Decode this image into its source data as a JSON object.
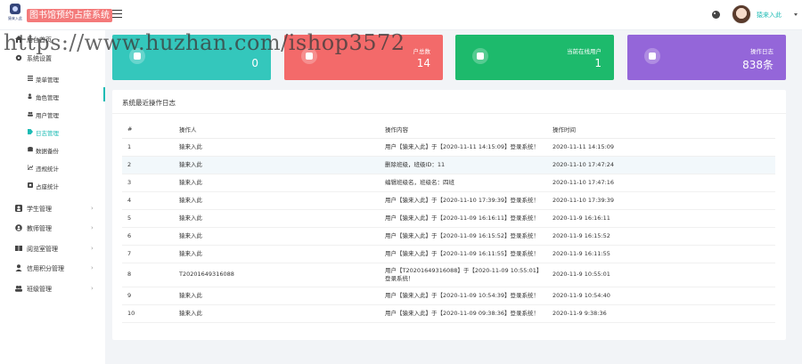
{
  "header": {
    "logo_text": "猿来入此",
    "app_title": "图书馆预约占座系统",
    "user_name": "猿来入此"
  },
  "watermark": "https://www.huzhan.com/ishop3572",
  "sidebar": {
    "items": [
      {
        "label": "后台首页",
        "icon": "home-icon"
      },
      {
        "label": "系统设置",
        "icon": "gear-icon"
      },
      {
        "label": "菜单管理",
        "icon": "list-icon"
      },
      {
        "label": "角色管理",
        "icon": "user-add-icon"
      },
      {
        "label": "用户管理",
        "icon": "users-icon"
      },
      {
        "label": "日志管理",
        "icon": "tag-icon"
      },
      {
        "label": "数据备份",
        "icon": "database-icon"
      },
      {
        "label": "违规统计",
        "icon": "chart-icon"
      },
      {
        "label": "占座统计",
        "icon": "square-icon"
      },
      {
        "label": "学生管理",
        "icon": "user-icon"
      },
      {
        "label": "教师管理",
        "icon": "user-circle-icon"
      },
      {
        "label": "阅览室管理",
        "icon": "book-icon"
      },
      {
        "label": "信用积分管理",
        "icon": "person-icon"
      },
      {
        "label": "班级管理",
        "icon": "group-icon"
      }
    ]
  },
  "cards": [
    {
      "label": "",
      "value": "0",
      "color": "#34c7bc"
    },
    {
      "label": "户总数",
      "value": "14",
      "color": "#f36a6a"
    },
    {
      "label": "当前在线用户",
      "value": "1",
      "color": "#1dba6c"
    },
    {
      "label": "操作日志",
      "value": "838条",
      "color": "#9466d9"
    }
  ],
  "log": {
    "title": "系统最近操作日志",
    "columns": [
      "#",
      "操作人",
      "操作内容",
      "操作时间"
    ],
    "rows": [
      [
        "1",
        "猿来入此",
        "用户【猿来入此】于【2020-11-11 14:15:09】登录系统！",
        "2020-11-11 14:15:09"
      ],
      [
        "2",
        "猿来入此",
        "删除班级，班级ID：11",
        "2020-11-10 17:47:24"
      ],
      [
        "3",
        "猿来入此",
        "编辑班级名，班级名：四班",
        "2020-11-10 17:47:16"
      ],
      [
        "4",
        "猿来入此",
        "用户【猿来入此】于【2020-11-10 17:39:39】登录系统！",
        "2020-11-10 17:39:39"
      ],
      [
        "5",
        "猿来入此",
        "用户【猿来入此】于【2020-11-09 16:16:11】登录系统！",
        "2020-11-9 16:16:11"
      ],
      [
        "6",
        "猿来入此",
        "用户【猿来入此】于【2020-11-09 16:15:52】登录系统！",
        "2020-11-9 16:15:52"
      ],
      [
        "7",
        "猿来入此",
        "用户【猿来入此】于【2020-11-09 16:11:55】登录系统！",
        "2020-11-9 16:11:55"
      ],
      [
        "8",
        "T20201649316088",
        "用户【T20201649316088】于【2020-11-09 10:55:01】登录系统！",
        "2020-11-9 10:55:01"
      ],
      [
        "9",
        "猿来入此",
        "用户【猿来入此】于【2020-11-09 10:54:39】登录系统！",
        "2020-11-9 10:54:40"
      ],
      [
        "10",
        "猿来入此",
        "用户【猿来入此】于【2020-11-09 09:38:36】登录系统！",
        "2020-11-9 9:38:36"
      ]
    ]
  }
}
